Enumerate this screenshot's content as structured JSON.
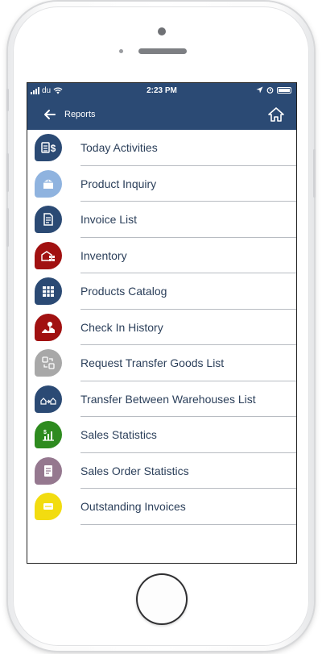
{
  "status": {
    "carrier": "du",
    "time": "2:23 PM"
  },
  "header": {
    "title": "Reports"
  },
  "colors": {
    "nav": "#2b4a74"
  },
  "items": [
    {
      "label": "Today Activities",
      "color": "#2b4a74",
      "icon": "cash-register-icon"
    },
    {
      "label": "Product Inquiry",
      "color": "#8fb3df",
      "icon": "box-icon"
    },
    {
      "label": "Invoice List",
      "color": "#2b4a74",
      "icon": "document-icon"
    },
    {
      "label": "Inventory",
      "color": "#a11111",
      "icon": "warehouse-icon"
    },
    {
      "label": "Products Catalog",
      "color": "#2b4a74",
      "icon": "grid-icon"
    },
    {
      "label": "Check In History",
      "color": "#a11111",
      "icon": "map-pin-icon"
    },
    {
      "label": "Request Transfer Goods List",
      "color": "#a8a8a8",
      "icon": "transfer-icon"
    },
    {
      "label": "Transfer Between Warehouses List",
      "color": "#2b4a74",
      "icon": "warehouses-transfer-icon"
    },
    {
      "label": "Sales Statistics",
      "color": "#2e8b1f",
      "icon": "sales-chart-icon"
    },
    {
      "label": "Sales Order Statistics",
      "color": "#95788f",
      "icon": "order-sheet-icon"
    },
    {
      "label": "Outstanding Invoices",
      "color": "#f2dc10",
      "icon": "invoice-card-icon"
    }
  ]
}
